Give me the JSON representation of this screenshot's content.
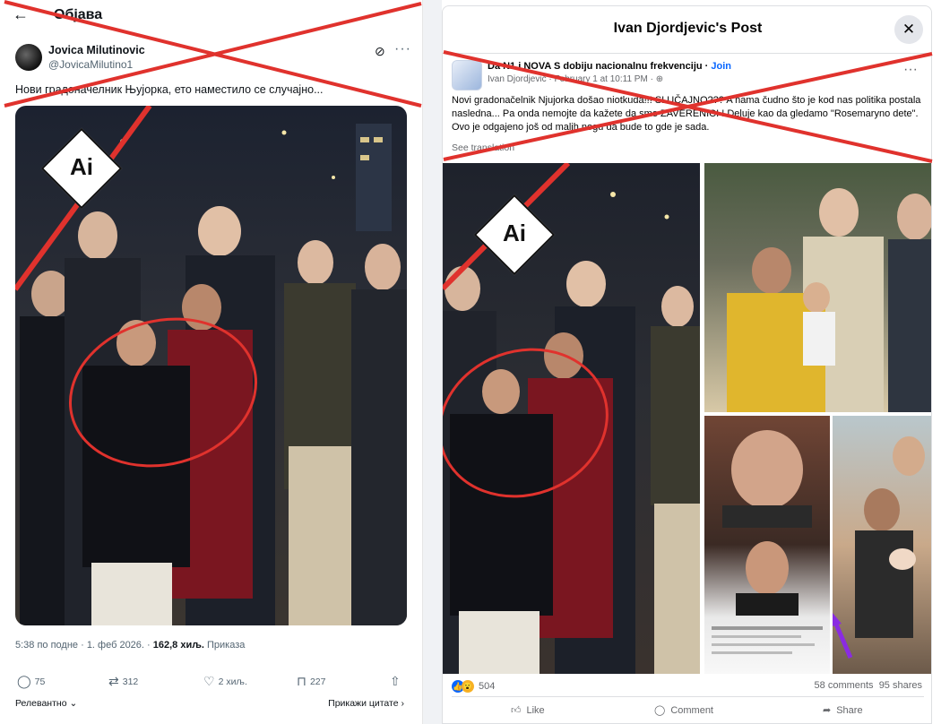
{
  "left_post": {
    "header_title": "Објава",
    "author_name": "Jovica Milutinovic",
    "author_handle": "@JovicaMilutino1",
    "text": "Нови градоначелник Њујорка, ето наместило се случајно...",
    "ai_label": "Ai",
    "meta_time": "5:38 по подне · 1. феб 2026. · ",
    "meta_views": "162,8 хиљ.",
    "meta_views_label": " Приказа",
    "replies": "75",
    "reposts": "312",
    "likes": "2 хиљ.",
    "bookmarks": "227",
    "sort_label": "Релевантно",
    "quotes_label": "Прикажи цитате"
  },
  "right_post": {
    "dialog_title": "Ivan Djordjevic's Post",
    "group_name": "Da N1 i NOVA S dobiju nacionalnu frekvenciju",
    "join_label": "Join",
    "author": "Ivan Djordjevic",
    "date": "February 1 at 10:11 PM",
    "text": "Novi gradonačelnik Njujorka došao niotkuda!!! SLUČAJNO??? A nama čudno što je kod nas politika postala nasledna... Pa onda nemojte da kažete da smo ZAVERENICI ! Deluje kao da gledamo \"Rosemaryno dete\". Ovo je odgajeno još od malih nogu da bude to gde je sada.",
    "see_translation": "See translation",
    "ai_label": "Ai",
    "reactions_count": "504",
    "comments_count": "58 comments",
    "shares_count": "95 shares",
    "like_label": "Like",
    "comment_label": "Comment",
    "share_label": "Share"
  },
  "colors": {
    "x_cross": "#e0322d",
    "circle": "#e0322d",
    "fb_blue": "#0866ff",
    "annotation_arrow": "#8a2be2"
  }
}
